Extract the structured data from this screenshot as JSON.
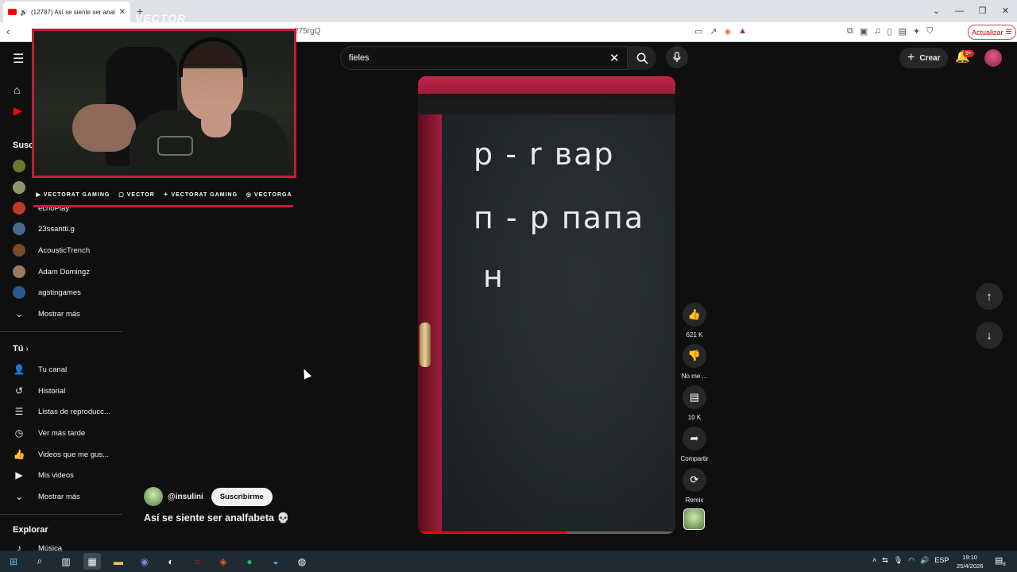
{
  "browser": {
    "tab_title": "(12787) Así se siente ser anal",
    "new_tab": "+",
    "url_fragment": "275rgQ",
    "update_label": "Actualizar"
  },
  "header": {
    "search_value": "fieles",
    "create_label": "Crear",
    "notification_badge": "9+"
  },
  "sidebar": {
    "subs_heading": "Susc",
    "channels": [
      {
        "name": "echoPlay",
        "color": "#c0392b"
      },
      {
        "name": "23ssantti.g",
        "color": "#4a6a8a"
      },
      {
        "name": "AcousticTrench",
        "color": "#7a4a2a"
      },
      {
        "name": "Adam Domingz",
        "color": "#9a7a5a"
      },
      {
        "name": "agstingames",
        "color": "#2a5a8a"
      }
    ],
    "show_more_subs": "Mostrar más",
    "you_heading": "Tú",
    "you_items": [
      {
        "label": "Tu canal",
        "icon": "user-icon"
      },
      {
        "label": "Historial",
        "icon": "history-icon"
      },
      {
        "label": "Listas de reproducc...",
        "icon": "playlist-icon"
      },
      {
        "label": "Ver más tarde",
        "icon": "clock-icon"
      },
      {
        "label": "Videos que me gus...",
        "icon": "thumb-up-icon"
      },
      {
        "label": "Mis videos",
        "icon": "video-icon"
      }
    ],
    "show_more_you": "Mostrar más",
    "explore_heading": "Explorar",
    "explore_items": [
      {
        "label": "Música",
        "icon": "music-icon"
      }
    ]
  },
  "overlay": {
    "logo": "VECTOR",
    "social": [
      "VECTORAT GAMING",
      "VECTOR",
      "VECTORAT GAMING",
      "VECTORGA"
    ]
  },
  "video": {
    "chalk_lines": [
      "р - r   вар",
      "п - р   папа",
      "н"
    ],
    "progress": 0.58
  },
  "channel": {
    "handle": "@insulini",
    "subscribe_label": "Suscribirme",
    "title": "Así se siente ser analfabeta 💀"
  },
  "actions": {
    "likes": "621 K",
    "dislike": "No me ...",
    "comments": "10 K",
    "share": "Compartir",
    "remix": "Remix"
  },
  "taskbar": {
    "lang": "ESP",
    "time": "19:10",
    "date": "25/4/2026",
    "notif_count": "8"
  },
  "colors": {
    "accent": "#ff0000",
    "overlay_red": "#c21b3f",
    "background": "#0f0f0f"
  }
}
